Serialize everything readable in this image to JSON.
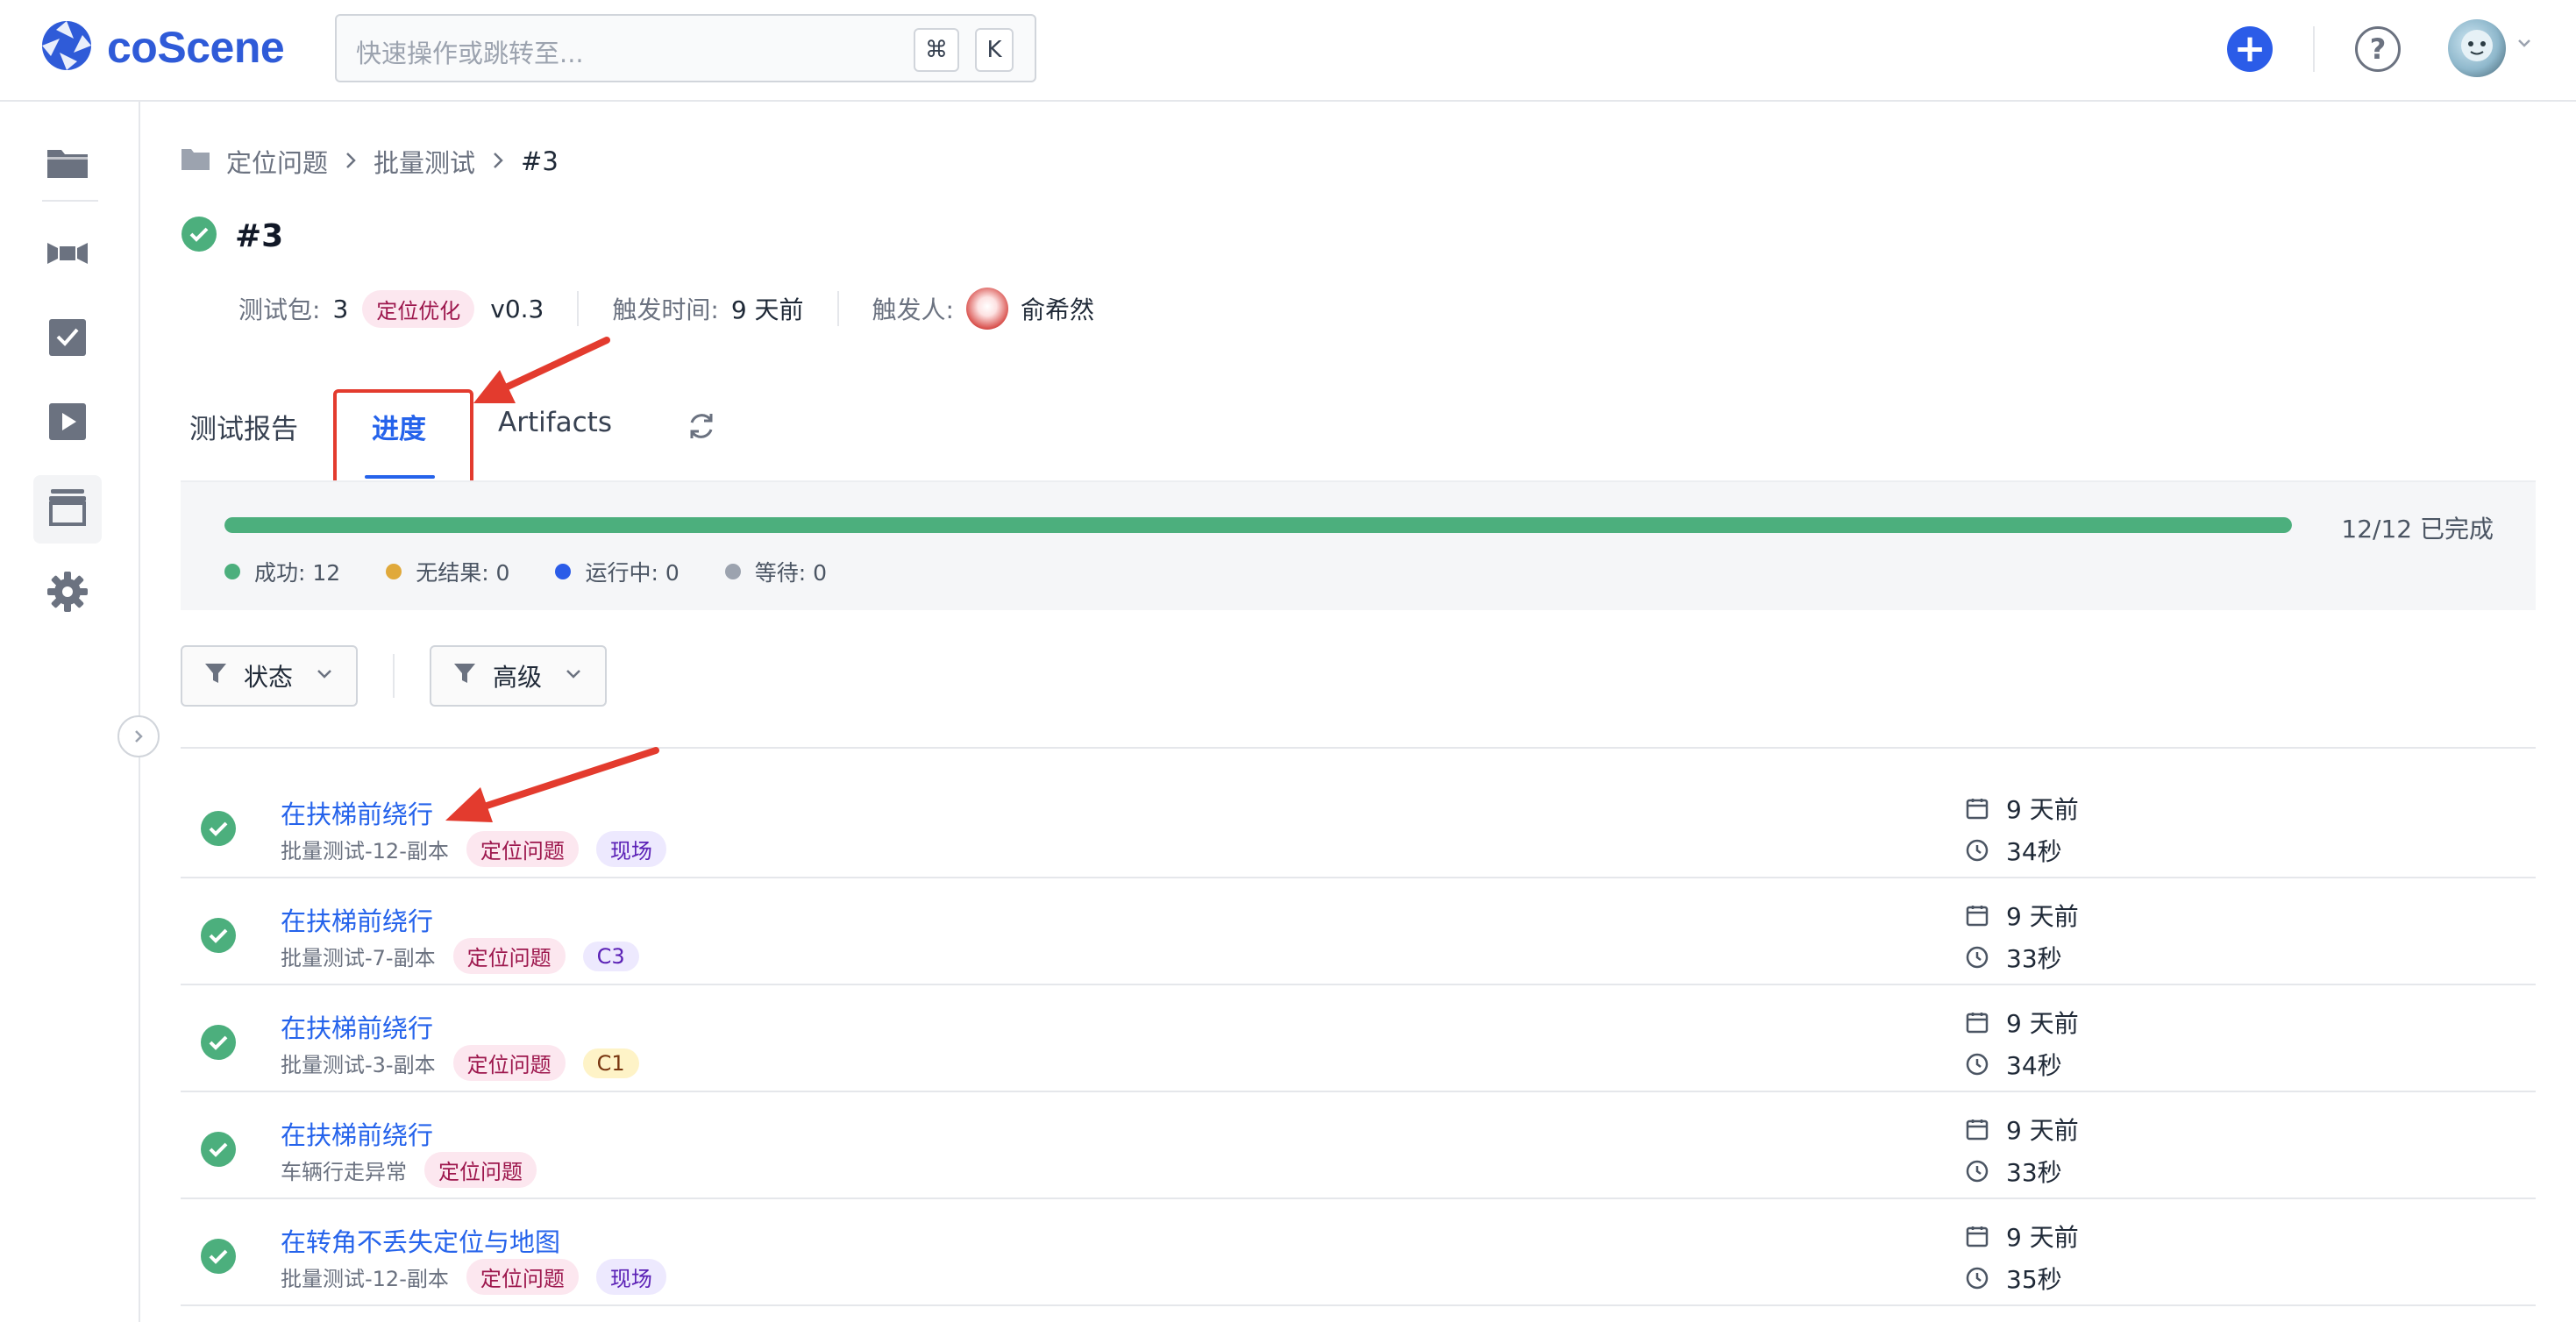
{
  "app": {
    "name": "coScene"
  },
  "search": {
    "placeholder": "快速操作或跳转至...",
    "kbd_cmd": "⌘",
    "kbd_k": "K"
  },
  "header": {
    "add_label": "+",
    "help_label": "?"
  },
  "breadcrumb": {
    "items": [
      "定位问题",
      "批量测试",
      "#3"
    ]
  },
  "page": {
    "title": "#3"
  },
  "meta": {
    "package_label": "测试包:",
    "package_value": "3",
    "package_tag": "定位优化",
    "package_version": "v0.3",
    "trigger_time_label": "触发时间:",
    "trigger_time_value": "9 天前",
    "trigger_user_label": "触发人:",
    "trigger_user_value": "俞希然"
  },
  "tabs": [
    {
      "label": "测试报告"
    },
    {
      "label": "进度"
    },
    {
      "label": "Artifacts"
    }
  ],
  "progress": {
    "done": 12,
    "total": 12,
    "fraction": 1.0,
    "text": "12/12 已完成",
    "legend": [
      {
        "label": "成功: 12",
        "color": "#4caf7d"
      },
      {
        "label": "无结果: 0",
        "color": "#e0a93b"
      },
      {
        "label": "运行中: 0",
        "color": "#2b5ce8"
      },
      {
        "label": "等待: 0",
        "color": "#9ca3af"
      }
    ]
  },
  "filters": {
    "status_label": "状态",
    "advanced_label": "高级"
  },
  "rows": [
    {
      "title": "在扶梯前绕行",
      "subtitle": "批量测试-12-副本",
      "tags": [
        {
          "text": "定位问题",
          "style": "pink"
        },
        {
          "text": "现场",
          "style": "purple"
        }
      ],
      "time": "9 天前",
      "duration": "34秒"
    },
    {
      "title": "在扶梯前绕行",
      "subtitle": "批量测试-7-副本",
      "tags": [
        {
          "text": "定位问题",
          "style": "pink"
        },
        {
          "text": "C3",
          "style": "purple"
        }
      ],
      "time": "9 天前",
      "duration": "33秒"
    },
    {
      "title": "在扶梯前绕行",
      "subtitle": "批量测试-3-副本",
      "tags": [
        {
          "text": "定位问题",
          "style": "pink"
        },
        {
          "text": "C1",
          "style": "yellow"
        }
      ],
      "time": "9 天前",
      "duration": "34秒"
    },
    {
      "title": "在扶梯前绕行",
      "subtitle": "车辆行走异常",
      "tags": [
        {
          "text": "定位问题",
          "style": "pink"
        }
      ],
      "time": "9 天前",
      "duration": "33秒"
    },
    {
      "title": "在转角不丢失定位与地图",
      "subtitle": "批量测试-12-副本",
      "tags": [
        {
          "text": "定位问题",
          "style": "pink"
        },
        {
          "text": "现场",
          "style": "purple"
        }
      ],
      "time": "9 天前",
      "duration": "35秒"
    }
  ]
}
